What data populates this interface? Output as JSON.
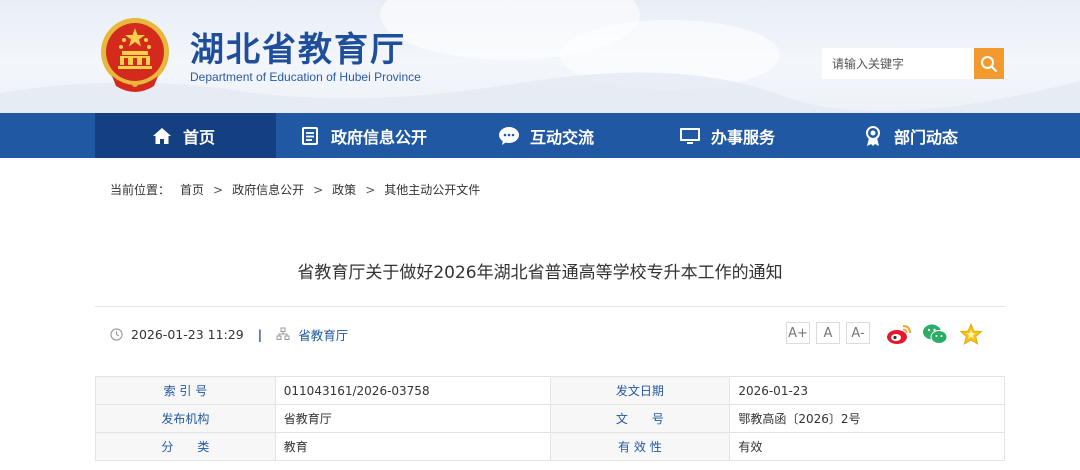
{
  "header": {
    "title": "湖北省教育厅",
    "subtitle": "Department of Education of Hubei Province",
    "search_placeholder": "请输入关键字",
    "colors": {
      "brand_blue": "#1f4f9a",
      "search_button": "#f29a2e"
    }
  },
  "nav": {
    "items": [
      {
        "label": "首页",
        "icon": "home-icon",
        "active": true
      },
      {
        "label": "政府信息公开",
        "icon": "document-list-icon",
        "active": false
      },
      {
        "label": "互动交流",
        "icon": "chat-bubble-icon",
        "active": false
      },
      {
        "label": "办事服务",
        "icon": "monitor-icon",
        "active": false
      },
      {
        "label": "部门动态",
        "icon": "award-ribbon-icon",
        "active": false
      }
    ],
    "colors": {
      "background": "#2158a3",
      "active": "#143f80"
    }
  },
  "breadcrumb": {
    "prefix": "当前位置：",
    "items": [
      "首页",
      "政府信息公开",
      "政策",
      "其他主动公开文件"
    ],
    "separator": ">"
  },
  "article": {
    "title": "省教育厅关于做好2026年湖北省普通高等学校专升本工作的通知",
    "datetime": "2026-01-23 11:29",
    "meta_separator": "|",
    "source": "省教育厅",
    "font_size_buttons": [
      "A+",
      "A",
      "A-"
    ],
    "share_icons": [
      "weibo-icon",
      "wechat-icon",
      "favorite-star-icon"
    ]
  },
  "info_table": {
    "rows": [
      [
        {
          "label": "索 引 号",
          "value": "011043161/2026-03758"
        },
        {
          "label": "发文日期",
          "value": "2026-01-23"
        }
      ],
      [
        {
          "label": "发布机构",
          "value": "省教育厅"
        },
        {
          "label": "文　　号",
          "value": "鄂教高函〔2026〕2号"
        }
      ],
      [
        {
          "label": "分　　类",
          "value": "教育"
        },
        {
          "label": "有 效 性",
          "value": "有效"
        }
      ]
    ]
  }
}
